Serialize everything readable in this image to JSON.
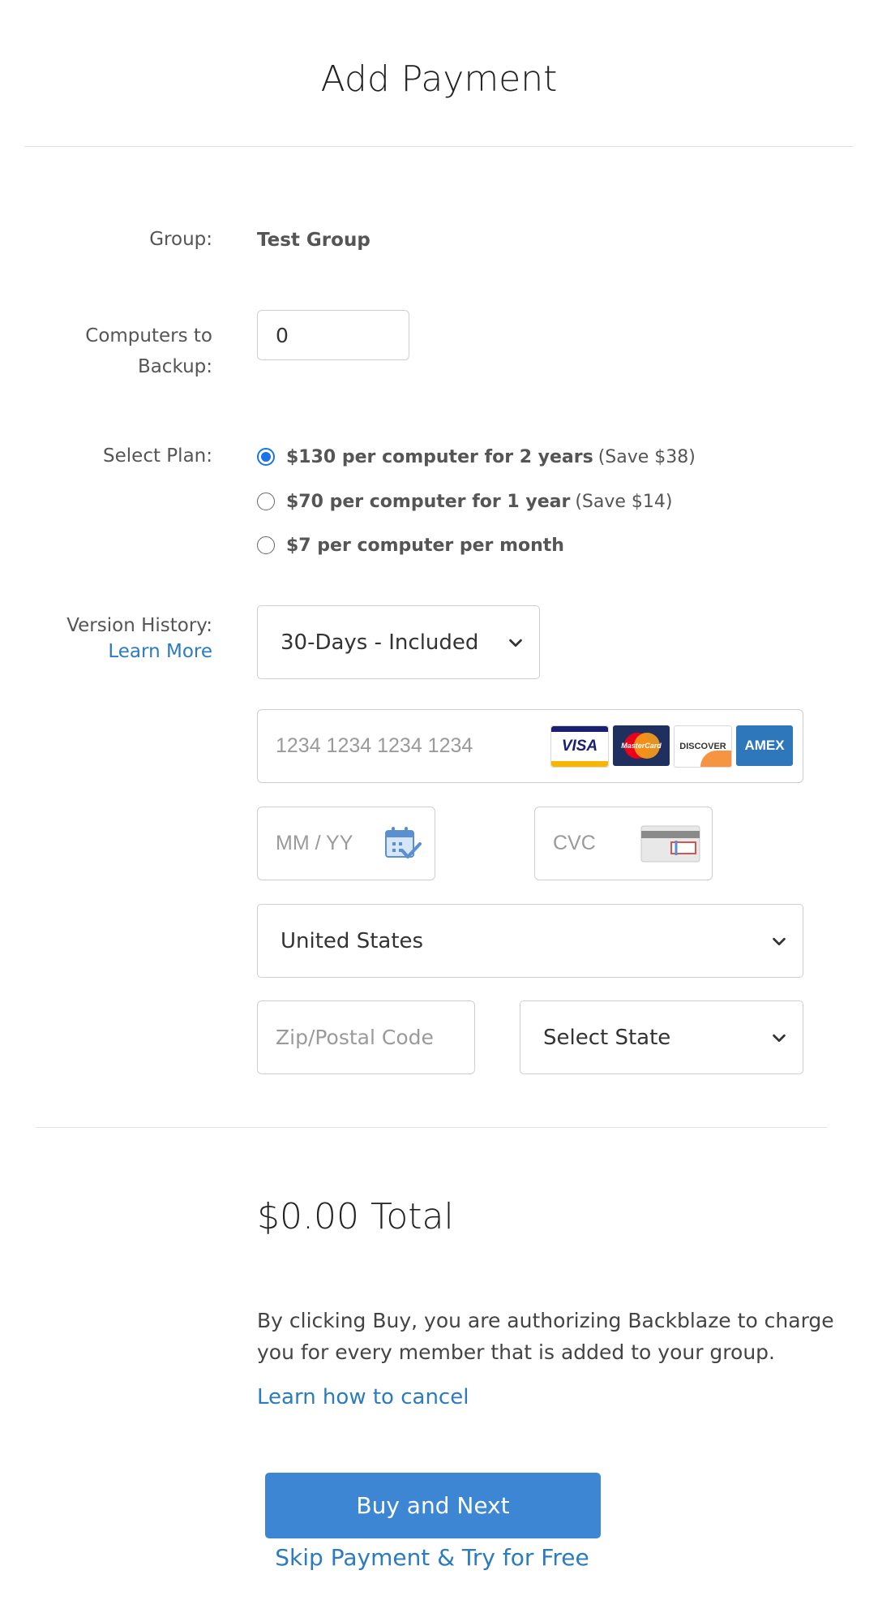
{
  "page": {
    "title": "Add Payment"
  },
  "form": {
    "group_label": "Group:",
    "group_value": "Test Group",
    "computers_label_line1": "Computers to",
    "computers_label_line2": "Backup:",
    "computers_value": "0",
    "plan_label": "Select Plan:",
    "plans": [
      {
        "bold": "$130 per computer for 2 years",
        "extra": "(Save $38)",
        "selected": true
      },
      {
        "bold": "$70 per computer for 1 year",
        "extra": "(Save $14)",
        "selected": false
      },
      {
        "bold": "$7 per computer per month",
        "extra": "",
        "selected": false
      }
    ],
    "version_label": "Version History:",
    "version_link": "Learn More",
    "version_selected": "30-Days - Included"
  },
  "payment": {
    "card_number_placeholder": "1234 1234 1234 1234",
    "card_brands": [
      "VISA",
      "MasterCard",
      "DISCOVER",
      "AMEX"
    ],
    "expiry_placeholder": "MM / YY",
    "cvc_placeholder": "CVC",
    "country_selected": "United States",
    "zip_placeholder": "Zip/Postal Code",
    "state_selected": "Select State"
  },
  "summary": {
    "total": "$0.00 Total",
    "notice_line1": "By clicking Buy, you are authorizing Backblaze to charge",
    "notice_line2": "you for every member that is added to your group.",
    "cancel_link": "Learn how to cancel",
    "buy_button": "Buy and Next",
    "skip_link": "Skip Payment & Try for Free"
  },
  "colors": {
    "accent": "#3d86d4",
    "link": "#2b7bc0",
    "radio": "#1a73e8"
  }
}
